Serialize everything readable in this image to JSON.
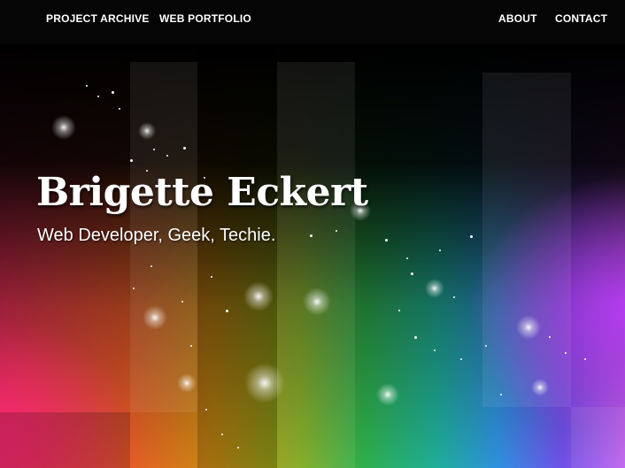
{
  "nav": {
    "left": [
      {
        "label": "PROJECT ARCHIVE"
      },
      {
        "label": "WEB PORTFOLIO"
      }
    ],
    "right": [
      {
        "label": "ABOUT"
      },
      {
        "label": "CONTACT"
      }
    ]
  },
  "hero": {
    "title": "Brigette Eckert",
    "subtitle": "Web Developer, Geek, Techie."
  }
}
